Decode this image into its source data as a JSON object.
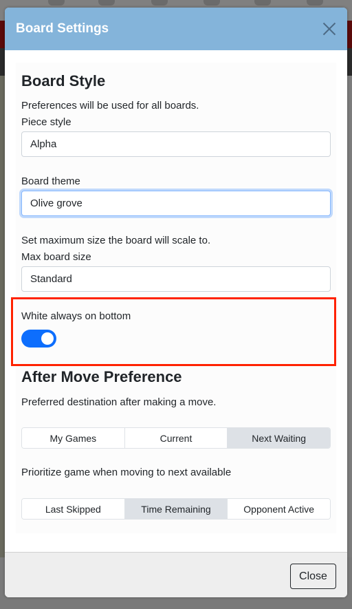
{
  "modal": {
    "title": "Board Settings",
    "close_icon": "close-x-icon",
    "header_color": "#84b4da"
  },
  "board_style": {
    "heading": "Board Style",
    "description": "Preferences will be used for all boards.",
    "piece_style": {
      "label": "Piece style",
      "value": "Alpha"
    },
    "board_theme": {
      "label": "Board theme",
      "value": "Olive grove"
    },
    "size_description": "Set maximum size the board will scale to.",
    "max_board_size": {
      "label": "Max board size",
      "value": "Standard"
    },
    "white_on_bottom": {
      "label": "White always on bottom",
      "checked": true
    }
  },
  "after_move": {
    "heading": "After Move Preference",
    "description": "Preferred destination after making a move.",
    "destination_options": [
      "My Games",
      "Current",
      "Next Waiting"
    ],
    "destination_selected": "Next Waiting",
    "prioritize_label": "Prioritize game when moving to next available",
    "priority_options": [
      "Last Skipped",
      "Time Remaining",
      "Opponent Active"
    ],
    "priority_selected": "Time Remaining"
  },
  "footer": {
    "close_label": "Close"
  },
  "colors": {
    "accent": "#0d6efd",
    "highlight_box": "#ff2200",
    "segment_active": "#dde1e6"
  }
}
